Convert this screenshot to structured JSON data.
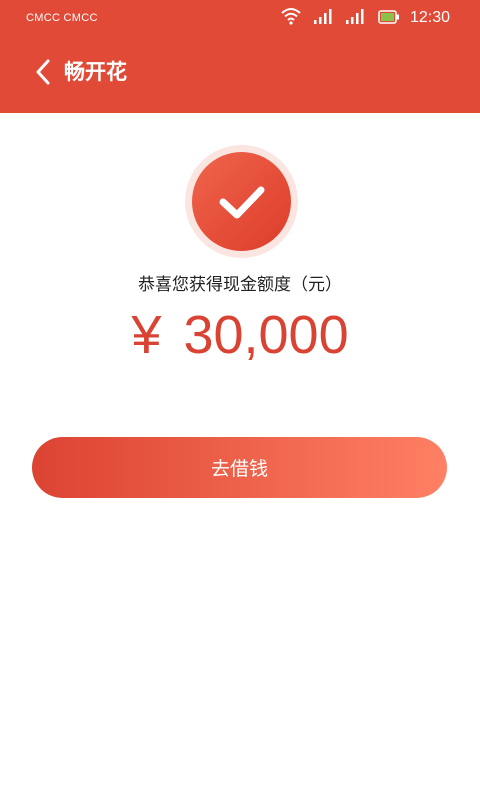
{
  "status_bar": {
    "carrier": "CMCC  CMCC",
    "time": "12:30",
    "icons": [
      "wifi-icon",
      "signal-icon",
      "signal-icon",
      "battery-icon"
    ]
  },
  "nav": {
    "back_icon": "chevron-left-icon",
    "title": "畅开花"
  },
  "result": {
    "icon": "check-icon",
    "message": "恭喜您获得现金额度（元）",
    "currency": "¥",
    "amount": "30,000"
  },
  "actions": {
    "borrow_label": "去借钱"
  },
  "colors": {
    "brand": "#E04A36",
    "amount": "#D94333",
    "button_gradient_start": "#DC4332",
    "button_gradient_end": "#FF8064"
  }
}
